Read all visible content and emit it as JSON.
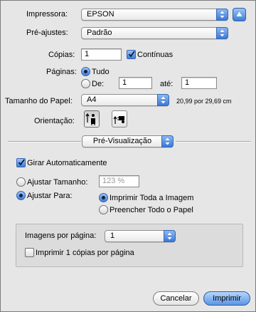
{
  "printer": {
    "label": "Impressora:",
    "value": "EPSON"
  },
  "presets": {
    "label": "Pré-ajustes:",
    "value": "Padrão"
  },
  "copies": {
    "label": "Cópias:",
    "value": "1",
    "collated_label": "Contínuas",
    "collated": true
  },
  "pages": {
    "label": "Páginas:",
    "all_label": "Tudo",
    "from_label": "De:",
    "from_value": "1",
    "to_label": "até:",
    "to_value": "1",
    "selected": "all"
  },
  "paper": {
    "label": "Tamanho do Papel:",
    "value": "A4",
    "dimensions": "20,99 por 29,69 cm"
  },
  "orientation": {
    "label": "Orientação:",
    "selected": "portrait"
  },
  "panel": {
    "value": "Pré-Visualização"
  },
  "auto_rotate": {
    "label": "Girar Automaticamente",
    "checked": true
  },
  "scale": {
    "label": "Ajustar Tamanho:",
    "value": "123 %",
    "enabled": false
  },
  "fit": {
    "label": "Ajustar Para:",
    "option_print_entire": "Imprimir Toda a Imagem",
    "option_fill_paper": "Preencher Todo o Papel",
    "selected": "print_entire"
  },
  "images_per_page": {
    "label": "Imagens por página:",
    "value": "1"
  },
  "copies_per_page": {
    "label": "Imprimir 1 cópias por página",
    "checked": false
  },
  "buttons": {
    "cancel": "Cancelar",
    "print": "Imprimir"
  },
  "colors": {
    "accent": "#3f7dd8",
    "window_bg": "#e6e6e6"
  },
  "icons": {
    "popup_arrows": "up-down-arrows-icon",
    "disclosure": "disclosure-triangle-icon",
    "checkmark": "checkmark-icon"
  }
}
